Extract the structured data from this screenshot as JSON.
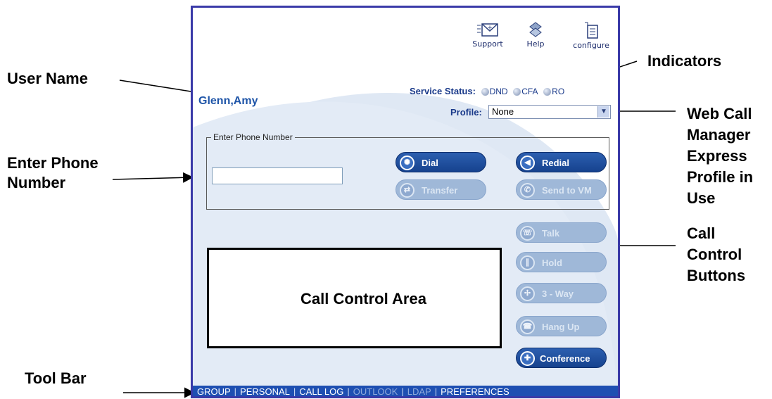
{
  "callouts": {
    "user_name": "User Name",
    "indicators": "Indicators",
    "enter_phone": "Enter Phone\nNumber",
    "profile": "Web Call\nManager\nExpress\nProfile in\nUse",
    "call_control": "Call\nControl\nButtons",
    "tool_bar": "Tool Bar"
  },
  "top_icons": [
    {
      "label": "Support",
      "icon": "support-envelope-icon"
    },
    {
      "label": "Help",
      "icon": "help-icon"
    },
    {
      "label": "configure",
      "icon": "configure-icon"
    }
  ],
  "user": {
    "name": "Glenn,Amy"
  },
  "service_status": {
    "label": "Service Status:",
    "indicators": [
      "DND",
      "CFA",
      "RO"
    ]
  },
  "profile": {
    "label": "Profile:",
    "value": "None"
  },
  "phone_entry": {
    "legend": "Enter Phone Number",
    "value": ""
  },
  "buttons": {
    "dial": "Dial",
    "redial": "Redial",
    "transfer": "Transfer",
    "send_to_vm": "Send to VM",
    "talk": "Talk",
    "hold": "Hold",
    "three_way": "3 - Way",
    "hang_up": "Hang Up",
    "conference": "Conference"
  },
  "call_control_area": {
    "label": "Call Control Area"
  },
  "toolbar": {
    "items": [
      "GROUP",
      "PERSONAL",
      "CALL LOG",
      "OUTLOOK",
      "LDAP",
      "PREFERENCES"
    ]
  },
  "colors": {
    "frame": "#3a3aa8",
    "accent": "#1e4fb2",
    "background": "#e3ebf6"
  }
}
